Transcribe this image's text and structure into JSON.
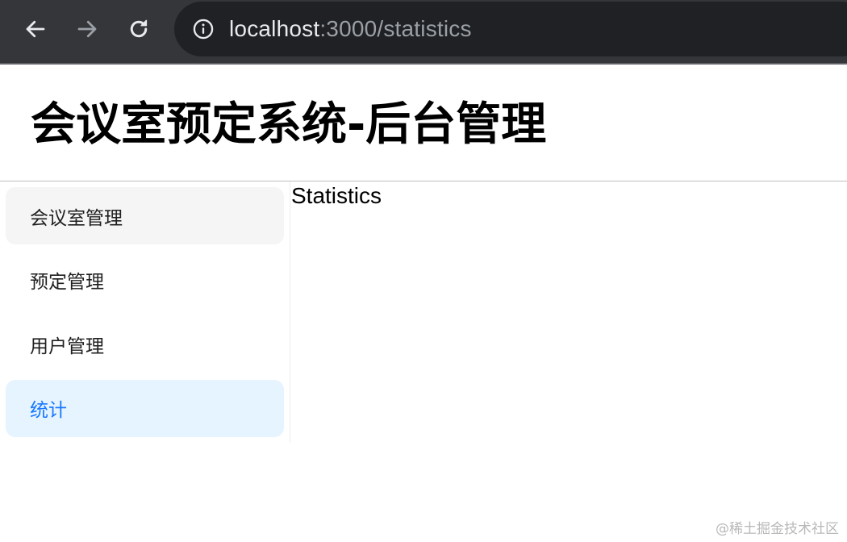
{
  "browser": {
    "url_host": "localhost",
    "url_rest": ":3000/statistics",
    "icons": [
      "back-arrow-icon",
      "forward-arrow-icon",
      "reload-icon",
      "info-icon"
    ],
    "colors": {
      "toolbar_bg": "#35363a",
      "omnibox_bg": "#202124",
      "icon_active": "#e8eaed",
      "icon_disabled": "#9aa0a6"
    }
  },
  "header": {
    "title": "会议室预定系统-后台管理"
  },
  "menu": {
    "items": [
      {
        "label": "会议室管理",
        "state": "hover"
      },
      {
        "label": "预定管理",
        "state": "normal"
      },
      {
        "label": "用户管理",
        "state": "normal"
      },
      {
        "label": "统计",
        "state": "selected"
      }
    ],
    "colors": {
      "selected_bg": "#e6f4ff",
      "selected_text": "#1677ff",
      "hover_bg": "#f5f5f5"
    }
  },
  "content": {
    "text": "Statistics"
  },
  "watermark": {
    "text": "@稀土掘金技术社区"
  }
}
